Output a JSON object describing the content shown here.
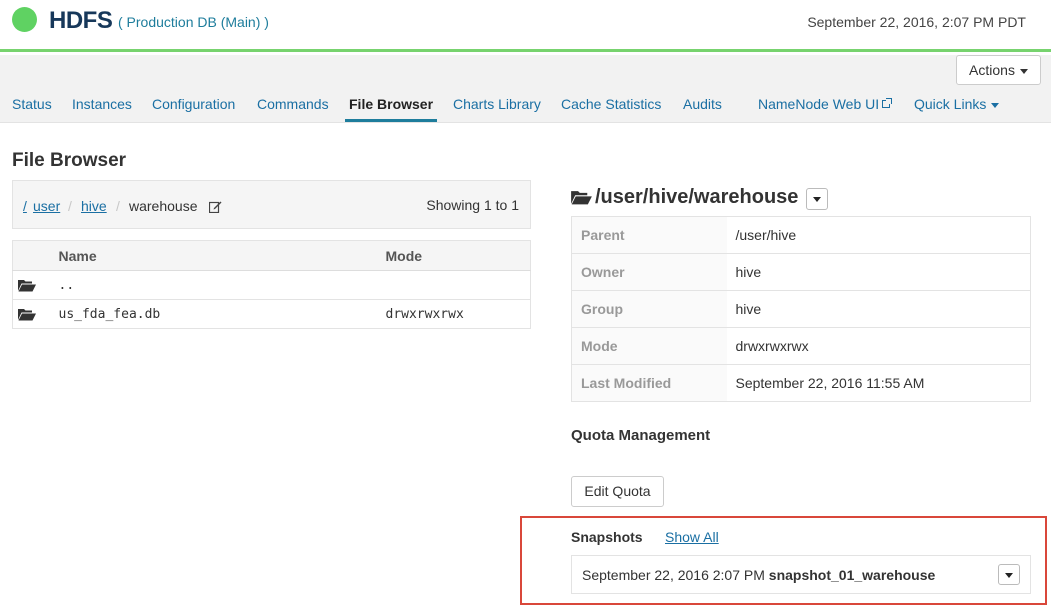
{
  "header": {
    "service_name": "HDFS",
    "cluster_name": "( Production DB (Main) )",
    "datetime": "September 22, 2016, 2:07 PM PDT",
    "status_color": "#5fd262"
  },
  "toolbar": {
    "actions_label": "Actions"
  },
  "tabs": [
    {
      "label": "Status"
    },
    {
      "label": "Instances"
    },
    {
      "label": "Configuration"
    },
    {
      "label": "Commands"
    },
    {
      "label": "File Browser"
    },
    {
      "label": "Charts Library"
    },
    {
      "label": "Cache Statistics"
    },
    {
      "label": "Audits"
    },
    {
      "label": "NameNode Web UI"
    },
    {
      "label": "Quick Links"
    }
  ],
  "active_tab": "File Browser",
  "page_title": "File Browser",
  "breadcrumb": {
    "root": "/",
    "items": [
      "user",
      "hive",
      "warehouse"
    ],
    "separator": "/",
    "showing": "Showing 1 to 1"
  },
  "file_table": {
    "columns": [
      "Name",
      "Mode"
    ],
    "rows": [
      {
        "name": "..",
        "mode": ""
      },
      {
        "name": "us_fda_fea.db",
        "mode": "drwxrwxrwx"
      }
    ]
  },
  "directory": {
    "path": "/user/hive/warehouse",
    "properties": [
      {
        "key": "Parent",
        "value": "/user/hive"
      },
      {
        "key": "Owner",
        "value": "hive"
      },
      {
        "key": "Group",
        "value": "hive"
      },
      {
        "key": "Mode",
        "value": "drwxrwxrwx"
      },
      {
        "key": "Last Modified",
        "value": "September 22, 2016 11:55 AM"
      }
    ]
  },
  "quota": {
    "title": "Quota Management",
    "edit_label": "Edit Quota"
  },
  "snapshots": {
    "title": "Snapshots",
    "show_all_label": "Show All",
    "items": [
      {
        "date": "September 22, 2016 2:07 PM",
        "name": "snapshot_01_warehouse"
      }
    ],
    "highlight_color": "#d9473a"
  }
}
